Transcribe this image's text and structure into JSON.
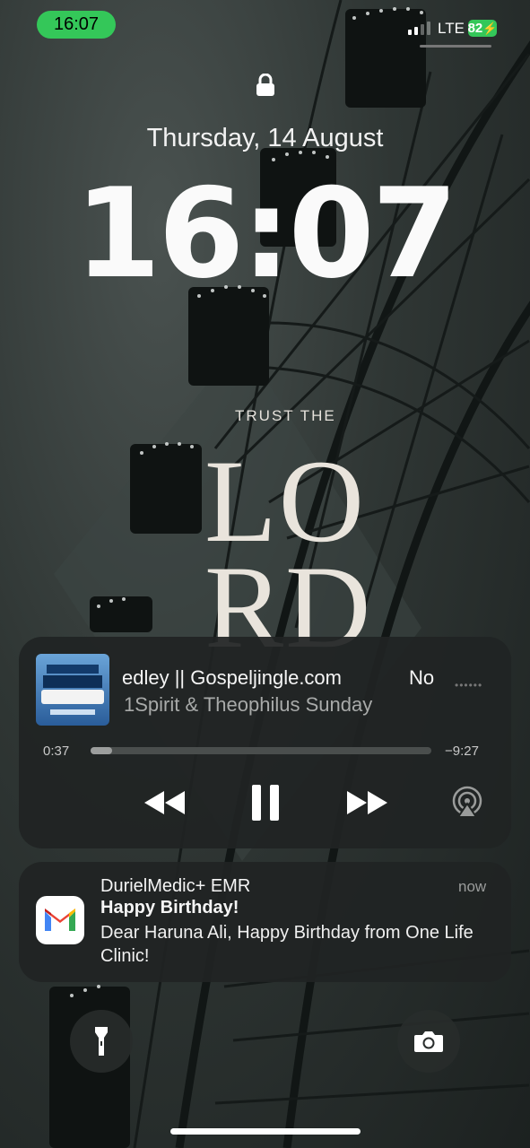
{
  "status_bar": {
    "time": "16:07",
    "network": "LTE",
    "battery": "82"
  },
  "lock_screen": {
    "date": "Thursday, 14 August",
    "clock": "16:07"
  },
  "wallpaper": {
    "line1": "TRUST THE",
    "line2": "LO",
    "line3": "RD"
  },
  "now_playing": {
    "title_visible": "edley || Gospeljingle.com",
    "title_next": "No",
    "artist": "1Spirit & Theophilus Sunday",
    "elapsed": "0:37",
    "remaining": "−9:27",
    "progress": 0.062,
    "artwork_icon": "album-artwork"
  },
  "notification": {
    "app": "DurielMedic+ EMR",
    "time": "now",
    "title": "Happy Birthday!",
    "body": "Dear Haruna Ali, Happy Birthday from One Life Clinic!",
    "icon": "gmail-icon"
  },
  "quick_actions": {
    "left_icon": "flashlight-icon",
    "right_icon": "camera-icon"
  },
  "colors": {
    "accent_green": "#34c759",
    "panel": "#202423",
    "gmail_red": "#ea4335",
    "gmail_blue": "#4285f4",
    "gmail_green": "#34a853",
    "gmail_yellow": "#fbbc04"
  }
}
